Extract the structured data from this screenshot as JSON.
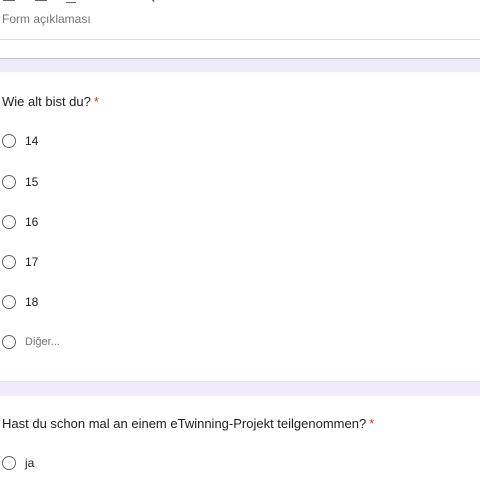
{
  "form": {
    "description_placeholder": "Form açıklaması"
  },
  "toolbar": {
    "icons": [
      "bold-icon",
      "italic-icon",
      "underline-icon",
      "link-icon"
    ]
  },
  "questions": [
    {
      "title": "Wie alt bist du?",
      "required_mark": "*",
      "options": [
        "14",
        "15",
        "16",
        "17",
        "18"
      ],
      "other_label": "Diğer..."
    },
    {
      "title": "Hast du schon mal an einem eTwinning-Projekt teilgenommen?",
      "required_mark": "*",
      "options": [
        "ja"
      ]
    }
  ],
  "colors": {
    "required": "#d93025",
    "section_background": "#f0ebf8",
    "radio_border": "#5f6368"
  }
}
